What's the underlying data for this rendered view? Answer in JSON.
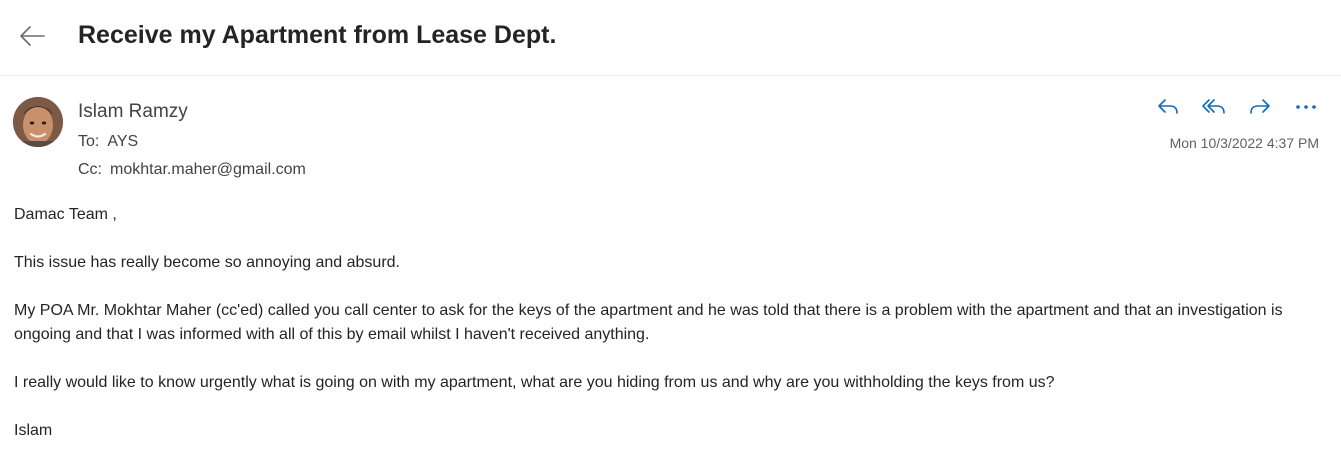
{
  "email": {
    "subject": "Receive my Apartment from Lease Dept.",
    "sender_name": "Islam Ramzy",
    "to_label": "To:",
    "to_value": "AYS",
    "cc_label": "Cc:",
    "cc_value": "mokhtar.maher@gmail.com",
    "timestamp": "Mon 10/3/2022 4:37 PM",
    "body": {
      "greeting": "Damac Team ,",
      "paragraph_1": "This issue has really become so annoying and absurd.",
      "paragraph_2": "My POA Mr. Mokhtar Maher (cc'ed) called you call center to ask for the keys of the apartment and he was told that there is a problem with the apartment and that an investigation is ongoing and that I was informed with all of this by email whilst I haven't received anything.",
      "paragraph_3": "I really would like to know urgently what is going on with my apartment, what are you hiding from us and why are you withholding the keys from us?",
      "signature": "Islam"
    }
  },
  "icons": {
    "back": "arrow-left-icon",
    "reply": "reply-icon",
    "reply_all": "reply-all-icon",
    "forward": "forward-icon",
    "more": "more-icon"
  },
  "colors": {
    "accent": "#0f6cbd",
    "text": "#242424",
    "secondary_text": "#616161",
    "divider": "#ececec"
  }
}
